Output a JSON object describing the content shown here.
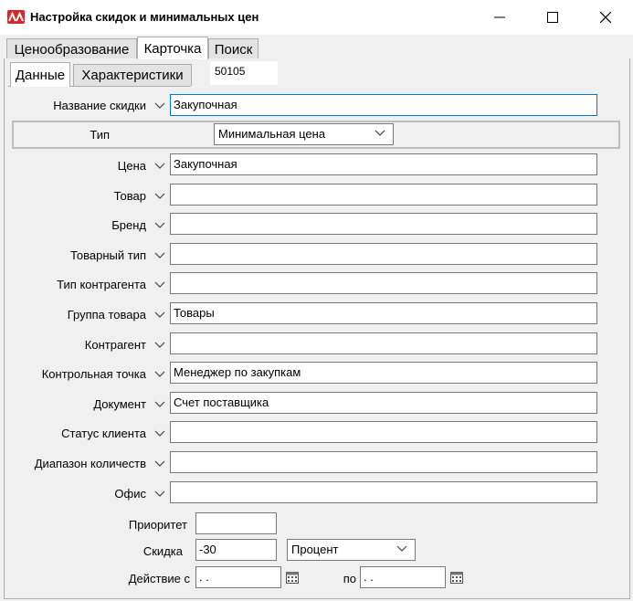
{
  "window": {
    "title": "Настройка скидок и минимальных цен",
    "minimize_icon": "minimize-icon",
    "maximize_icon": "maximize-icon",
    "close_icon": "close-icon"
  },
  "tabs": [
    {
      "label": "Ценообразование",
      "active": false
    },
    {
      "label": "Карточка",
      "active": true
    },
    {
      "label": "Поиск",
      "active": false
    }
  ],
  "subtabs": [
    {
      "label": "Данные",
      "active": true
    },
    {
      "label": "Характеристики",
      "active": false
    }
  ],
  "record_code": "50105",
  "form": {
    "discount_name": {
      "label": "Название скидки",
      "value": "Закупочная"
    },
    "type": {
      "label": "Тип",
      "value": "Минимальная цена"
    },
    "rows": [
      {
        "label": "Цена",
        "value": "Закупочная"
      },
      {
        "label": "Товар",
        "value": ""
      },
      {
        "label": "Бренд",
        "value": ""
      },
      {
        "label": "Товарный тип",
        "value": ""
      },
      {
        "label": "Тип контрагента",
        "value": ""
      },
      {
        "label": "Группа товара",
        "value": "Товары"
      },
      {
        "label": "Контрагент",
        "value": ""
      },
      {
        "label": "Контрольная точка",
        "value": "Менеджер по закупкам"
      },
      {
        "label": "Документ",
        "value": "Счет поставщика"
      },
      {
        "label": "Статус клиента",
        "value": ""
      },
      {
        "label": "Диапазон количеств",
        "value": ""
      },
      {
        "label": "Офис",
        "value": ""
      }
    ],
    "priority": {
      "label": "Приоритет",
      "value": ""
    },
    "discount": {
      "label": "Скидка",
      "value": "-30",
      "unit": "Процент"
    },
    "valid_from": {
      "label": "Действие с",
      "value": " .  ."
    },
    "valid_to": {
      "label": "по",
      "value": " .  ."
    }
  },
  "colors": {
    "accent": "#0078d7",
    "logo": "#d8262b"
  }
}
